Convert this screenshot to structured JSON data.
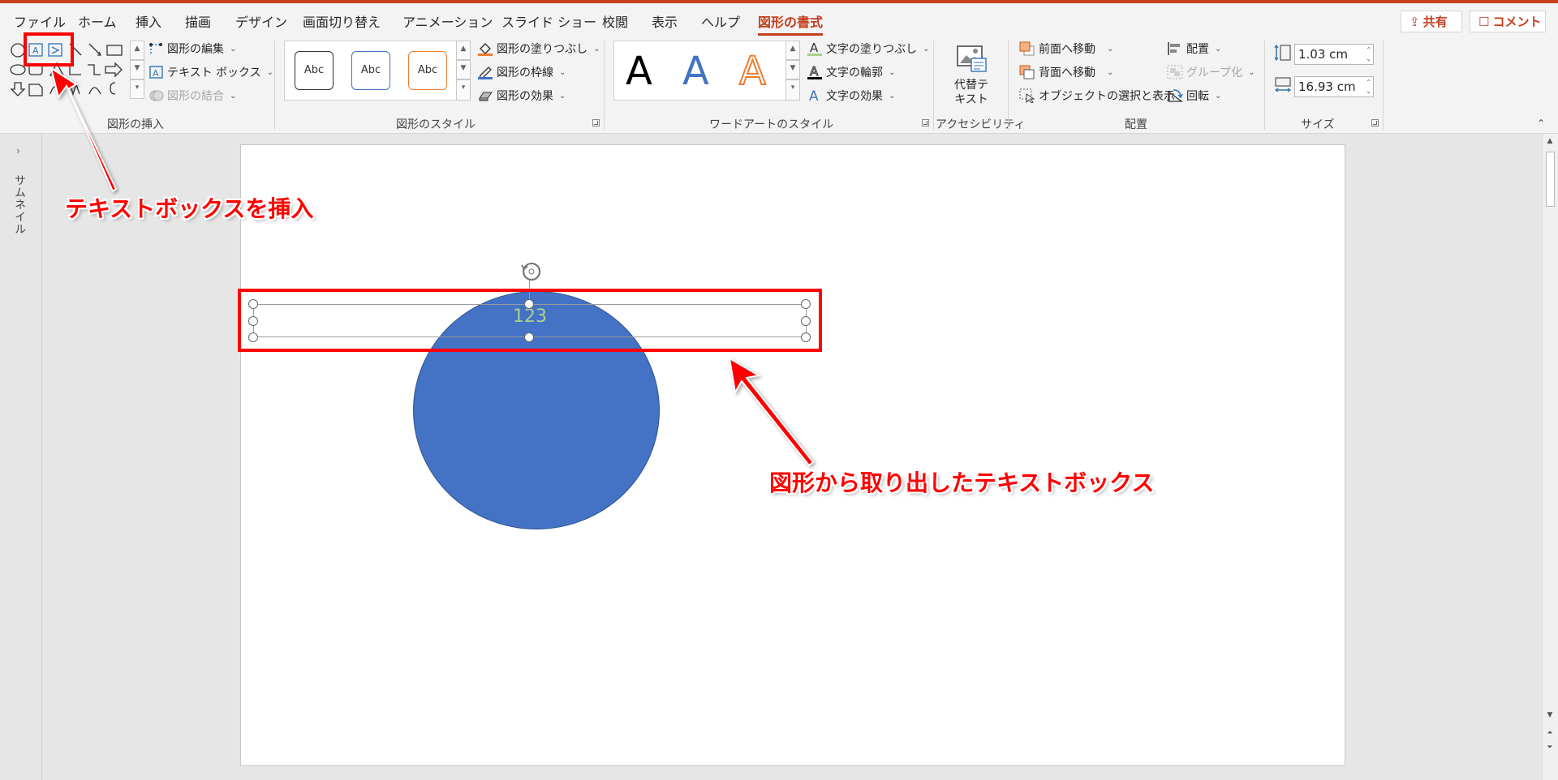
{
  "tabs": [
    {
      "label": "ファイル",
      "active": false
    },
    {
      "label": "ホーム",
      "active": false
    },
    {
      "label": "挿入",
      "active": false
    },
    {
      "label": "描画",
      "active": false
    },
    {
      "label": "デザイン",
      "active": false
    },
    {
      "label": "画面切り替え",
      "active": false
    },
    {
      "label": "アニメーション",
      "active": false
    },
    {
      "label": "スライド ショー",
      "active": false
    },
    {
      "label": "校閲",
      "active": false
    },
    {
      "label": "表示",
      "active": false
    },
    {
      "label": "ヘルプ",
      "active": false
    },
    {
      "label": "図形の書式",
      "active": true
    }
  ],
  "header": {
    "share_label": "共有",
    "comment_label": "コメント"
  },
  "ribbon": {
    "insert_shapes": {
      "edit_shape": "図形の編集",
      "text_box": "テキスト ボックス",
      "merge_shapes": "図形の結合",
      "group_label": "図形の挿入"
    },
    "shape_styles": {
      "samples": [
        "Abc",
        "Abc",
        "Abc"
      ],
      "fill": "図形の塗りつぶし",
      "outline": "図形の枠線",
      "effects": "図形の効果",
      "group_label": "図形のスタイル"
    },
    "wordart": {
      "samples": [
        "A",
        "A",
        "A"
      ],
      "text_fill": "文字の塗りつぶし",
      "text_outline": "文字の輪郭",
      "text_effects": "文字の効果",
      "group_label": "ワードアートのスタイル"
    },
    "accessibility": {
      "alt_text_line1": "代替テ",
      "alt_text_line2": "キスト",
      "group_label": "アクセシビリティ"
    },
    "arrange": {
      "bring_forward": "前面へ移動",
      "send_backward": "背面へ移動",
      "selection_pane": "オブジェクトの選択と表示",
      "align": "配置",
      "group": "グループ化",
      "rotate": "回転",
      "group_label": "配置"
    },
    "size": {
      "height": "1.03 cm",
      "width": "16.93 cm",
      "group_label": "サイズ"
    }
  },
  "thumbnail_pane": {
    "label": "サムネイル"
  },
  "slide": {
    "textbox_text": "123",
    "circle_color": "#4472c4",
    "textbox_text_color": "#a9d18e"
  },
  "annotations": {
    "insert_textbox": "テキストボックスを挿入",
    "extracted_textbox": "図形から取り出したテキストボックス",
    "color": "#ff0000"
  },
  "colors": {
    "accent": "#c43e1c",
    "ribbon_bg": "#f3f3f3"
  }
}
